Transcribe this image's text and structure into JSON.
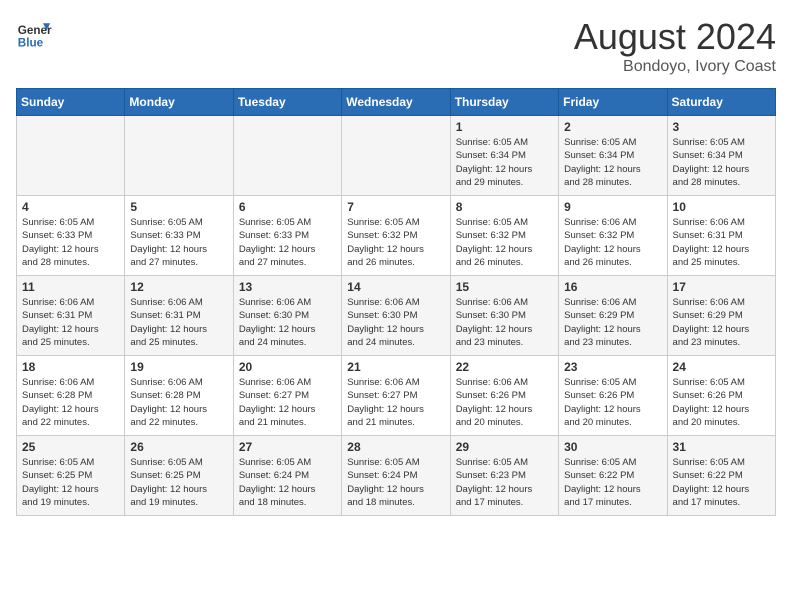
{
  "header": {
    "logo_line1": "General",
    "logo_line2": "Blue",
    "title": "August 2024",
    "subtitle": "Bondoyo, Ivory Coast"
  },
  "days_of_week": [
    "Sunday",
    "Monday",
    "Tuesday",
    "Wednesday",
    "Thursday",
    "Friday",
    "Saturday"
  ],
  "weeks": [
    [
      {
        "day": "",
        "info": ""
      },
      {
        "day": "",
        "info": ""
      },
      {
        "day": "",
        "info": ""
      },
      {
        "day": "",
        "info": ""
      },
      {
        "day": "1",
        "info": "Sunrise: 6:05 AM\nSunset: 6:34 PM\nDaylight: 12 hours\nand 29 minutes."
      },
      {
        "day": "2",
        "info": "Sunrise: 6:05 AM\nSunset: 6:34 PM\nDaylight: 12 hours\nand 28 minutes."
      },
      {
        "day": "3",
        "info": "Sunrise: 6:05 AM\nSunset: 6:34 PM\nDaylight: 12 hours\nand 28 minutes."
      }
    ],
    [
      {
        "day": "4",
        "info": "Sunrise: 6:05 AM\nSunset: 6:33 PM\nDaylight: 12 hours\nand 28 minutes."
      },
      {
        "day": "5",
        "info": "Sunrise: 6:05 AM\nSunset: 6:33 PM\nDaylight: 12 hours\nand 27 minutes."
      },
      {
        "day": "6",
        "info": "Sunrise: 6:05 AM\nSunset: 6:33 PM\nDaylight: 12 hours\nand 27 minutes."
      },
      {
        "day": "7",
        "info": "Sunrise: 6:05 AM\nSunset: 6:32 PM\nDaylight: 12 hours\nand 26 minutes."
      },
      {
        "day": "8",
        "info": "Sunrise: 6:05 AM\nSunset: 6:32 PM\nDaylight: 12 hours\nand 26 minutes."
      },
      {
        "day": "9",
        "info": "Sunrise: 6:06 AM\nSunset: 6:32 PM\nDaylight: 12 hours\nand 26 minutes."
      },
      {
        "day": "10",
        "info": "Sunrise: 6:06 AM\nSunset: 6:31 PM\nDaylight: 12 hours\nand 25 minutes."
      }
    ],
    [
      {
        "day": "11",
        "info": "Sunrise: 6:06 AM\nSunset: 6:31 PM\nDaylight: 12 hours\nand 25 minutes."
      },
      {
        "day": "12",
        "info": "Sunrise: 6:06 AM\nSunset: 6:31 PM\nDaylight: 12 hours\nand 25 minutes."
      },
      {
        "day": "13",
        "info": "Sunrise: 6:06 AM\nSunset: 6:30 PM\nDaylight: 12 hours\nand 24 minutes."
      },
      {
        "day": "14",
        "info": "Sunrise: 6:06 AM\nSunset: 6:30 PM\nDaylight: 12 hours\nand 24 minutes."
      },
      {
        "day": "15",
        "info": "Sunrise: 6:06 AM\nSunset: 6:30 PM\nDaylight: 12 hours\nand 23 minutes."
      },
      {
        "day": "16",
        "info": "Sunrise: 6:06 AM\nSunset: 6:29 PM\nDaylight: 12 hours\nand 23 minutes."
      },
      {
        "day": "17",
        "info": "Sunrise: 6:06 AM\nSunset: 6:29 PM\nDaylight: 12 hours\nand 23 minutes."
      }
    ],
    [
      {
        "day": "18",
        "info": "Sunrise: 6:06 AM\nSunset: 6:28 PM\nDaylight: 12 hours\nand 22 minutes."
      },
      {
        "day": "19",
        "info": "Sunrise: 6:06 AM\nSunset: 6:28 PM\nDaylight: 12 hours\nand 22 minutes."
      },
      {
        "day": "20",
        "info": "Sunrise: 6:06 AM\nSunset: 6:27 PM\nDaylight: 12 hours\nand 21 minutes."
      },
      {
        "day": "21",
        "info": "Sunrise: 6:06 AM\nSunset: 6:27 PM\nDaylight: 12 hours\nand 21 minutes."
      },
      {
        "day": "22",
        "info": "Sunrise: 6:06 AM\nSunset: 6:26 PM\nDaylight: 12 hours\nand 20 minutes."
      },
      {
        "day": "23",
        "info": "Sunrise: 6:05 AM\nSunset: 6:26 PM\nDaylight: 12 hours\nand 20 minutes."
      },
      {
        "day": "24",
        "info": "Sunrise: 6:05 AM\nSunset: 6:26 PM\nDaylight: 12 hours\nand 20 minutes."
      }
    ],
    [
      {
        "day": "25",
        "info": "Sunrise: 6:05 AM\nSunset: 6:25 PM\nDaylight: 12 hours\nand 19 minutes."
      },
      {
        "day": "26",
        "info": "Sunrise: 6:05 AM\nSunset: 6:25 PM\nDaylight: 12 hours\nand 19 minutes."
      },
      {
        "day": "27",
        "info": "Sunrise: 6:05 AM\nSunset: 6:24 PM\nDaylight: 12 hours\nand 18 minutes."
      },
      {
        "day": "28",
        "info": "Sunrise: 6:05 AM\nSunset: 6:24 PM\nDaylight: 12 hours\nand 18 minutes."
      },
      {
        "day": "29",
        "info": "Sunrise: 6:05 AM\nSunset: 6:23 PM\nDaylight: 12 hours\nand 17 minutes."
      },
      {
        "day": "30",
        "info": "Sunrise: 6:05 AM\nSunset: 6:22 PM\nDaylight: 12 hours\nand 17 minutes."
      },
      {
        "day": "31",
        "info": "Sunrise: 6:05 AM\nSunset: 6:22 PM\nDaylight: 12 hours\nand 17 minutes."
      }
    ]
  ]
}
